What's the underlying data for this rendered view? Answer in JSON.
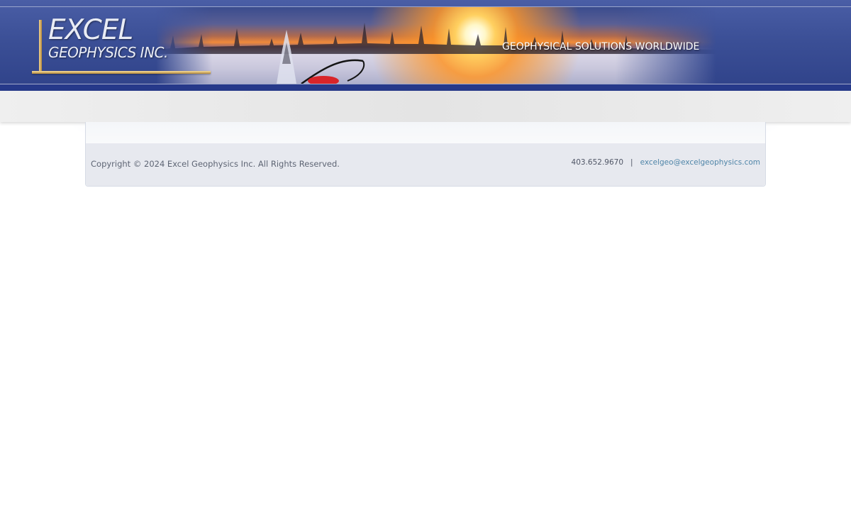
{
  "header": {
    "logo": {
      "brand": "EXCEL",
      "subtitle": "GEOPHYSICS INC."
    },
    "tagline": "GEOPHYSICAL SOLUTIONS WORLDWIDE"
  },
  "footer": {
    "copyright": "Copyright © 2024 Excel Geophysics Inc. All Rights Reserved.",
    "phone": "403.652.9670",
    "separator": "|",
    "email": "excelgeo@excelgeophysics.com"
  },
  "colors": {
    "header_blue": "#3b4f96",
    "logo_gold": "#d9b46a",
    "link": "#4f85a8",
    "footer_bg": "#e7e9ef"
  }
}
